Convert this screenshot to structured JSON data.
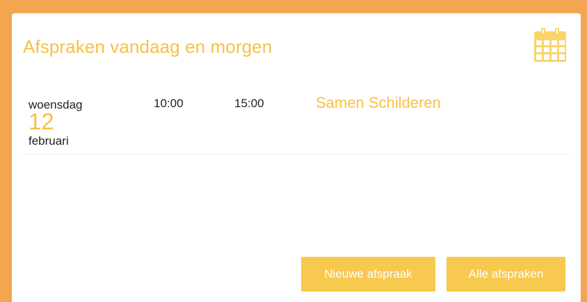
{
  "card": {
    "title": "Afspraken vandaag en morgen",
    "icon": "calendar-icon"
  },
  "appointments": [
    {
      "weekday": "woensdag",
      "day": "12",
      "month": "februari",
      "start": "10:00",
      "end": "15:00",
      "title": "Samen Schilderen"
    }
  ],
  "buttons": {
    "new_label": "Nieuwe afspraak",
    "all_label": "Alle afspraken"
  },
  "colors": {
    "frame": "#f3a64f",
    "accent": "#f7c144",
    "button": "#f8c94f",
    "icon": "#fad56a"
  }
}
